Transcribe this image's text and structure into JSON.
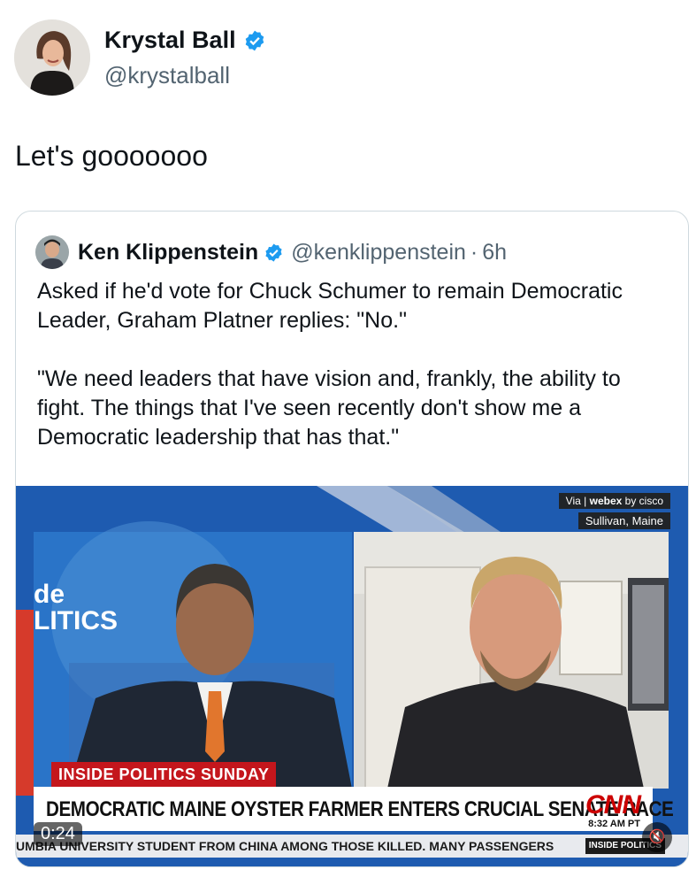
{
  "author": {
    "name": "Krystal Ball",
    "handle": "@krystalball"
  },
  "tweet": {
    "text": "Let's gooooooo"
  },
  "quoted": {
    "name": "Ken Klippenstein",
    "handle": "@kenklippenstein",
    "separator": "·",
    "time": "6h",
    "paragraphs": [
      "Asked if he'd vote for Chuck Schumer to remain Democratic Leader, Graham Platner replies: \"No.\"",
      "\"We need leaders that have vision and, frankly, the ability to fight. The things that I've seen recently don't show me a Democratic leadership that has that.\""
    ]
  },
  "video": {
    "via_label": "Via",
    "via_brand": "webex",
    "via_by": "by cisco",
    "location": "Sullivan, Maine",
    "show_logo_line1": "de",
    "show_logo_line2": "LITICS",
    "program": "INSIDE POLITICS SUNDAY",
    "headline": "DEMOCRATIC MAINE OYSTER FARMER ENTERS CRUCIAL SENATE RACE",
    "network": "CNN",
    "clock": "8:32 AM PT",
    "ticker": "UMBIA UNIVERSITY STUDENT FROM CHINA AMONG THOSE KILLED. MANY PASSENGERS",
    "ticker_tag": "INSIDE POLITICS",
    "duration": "0:24",
    "mute_icon": "speaker-muted-icon"
  },
  "colors": {
    "verified": "#1d9bf0",
    "cnn_red": "#cc0000",
    "text_secondary": "#536471"
  }
}
